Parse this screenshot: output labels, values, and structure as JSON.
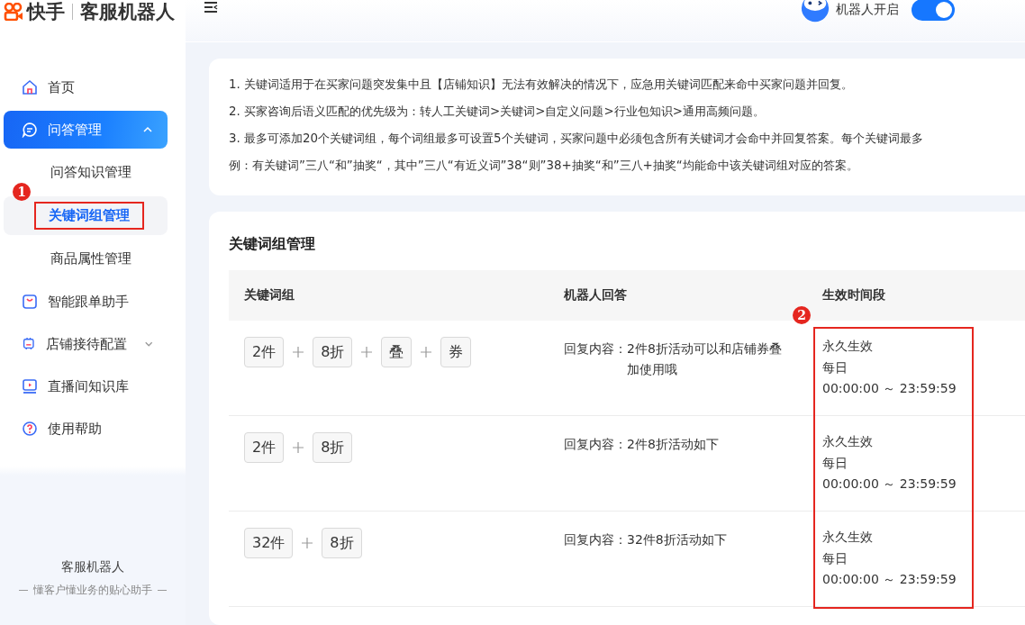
{
  "brand": {
    "name": "快手",
    "product": "客服机器人"
  },
  "top_bar": {
    "robot_label": "机器人开启",
    "robot_on": true
  },
  "sidebar": {
    "items": [
      {
        "label": "首页",
        "selected": false
      },
      {
        "label": "问答管理",
        "selected": true,
        "expanded": true,
        "children": [
          {
            "label": "问答知识管理",
            "selected": false
          },
          {
            "label": "关键词组管理",
            "selected": true
          },
          {
            "label": "商品属性管理",
            "selected": false
          }
        ]
      },
      {
        "label": "智能跟单助手",
        "selected": false
      },
      {
        "label": "店铺接待配置",
        "selected": false,
        "expanded": false
      },
      {
        "label": "直播间知识库",
        "selected": false
      },
      {
        "label": "使用帮助",
        "selected": false
      }
    ],
    "footer": {
      "title": "客服机器人",
      "tagline": "懂客户懂业务的贴心助手"
    }
  },
  "notice": {
    "lines": [
      "1. 关键词适用于在买家问题突发集中且【店铺知识】无法有效解决的情况下，应急用关键词匹配来命中买家问题并回复。",
      "2. 买家咨询后语义匹配的优先级为：转人工关键词>关键词>自定义问题>行业包知识>通用高频问题。",
      "3. 最多可添加20个关键词组，每个词组最多可设置5个关键词，买家问题中必须包含所有关键词才会命中并回复答案。每个关键词最多",
      "例：有关键词”三八“和”抽奖“，其中”三八“有近义词”38“则”38+抽奖“和”三八+抽奖“均能命中该关键词组对应的答案。"
    ]
  },
  "table": {
    "title": "关键词组管理",
    "columns": [
      "关键词组",
      "机器人回答",
      "生效时间段"
    ],
    "rows": [
      {
        "keywords": [
          "2件",
          "8折",
          "叠",
          "券"
        ],
        "reply_label": "回复内容：",
        "reply": "2件8折活动可以和店铺券叠加使用哦",
        "validity": "永久生效",
        "days": "每日",
        "time_range": "00:00:00 ～ 23:59:59"
      },
      {
        "keywords": [
          "2件",
          "8折"
        ],
        "reply_label": "回复内容：",
        "reply": "2件8折活动如下",
        "validity": "永久生效",
        "days": "每日",
        "time_range": "00:00:00 ～ 23:59:59"
      },
      {
        "keywords": [
          "32件",
          "8折"
        ],
        "reply_label": "回复内容：",
        "reply": "32件8折活动如下",
        "validity": "永久生效",
        "days": "每日",
        "time_range": "00:00:00 ～ 23:59:59"
      }
    ]
  },
  "annotations": [
    {
      "label": "1"
    },
    {
      "label": "2"
    }
  ]
}
